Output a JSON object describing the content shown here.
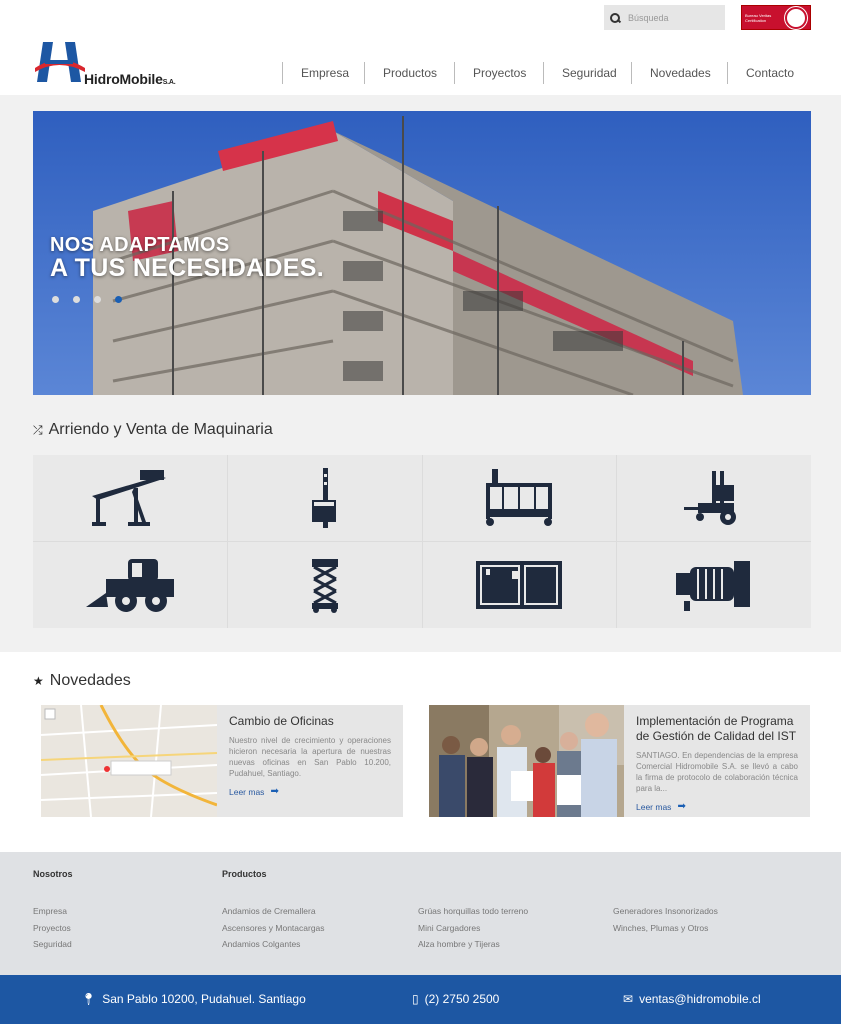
{
  "header": {
    "search_placeholder": "Búsqueda",
    "search_icon": "magnifier-icon",
    "cert_text": "Bureau Veritas Certification",
    "logo_brand": "HidroMobile",
    "logo_suffix": "S.A.",
    "nav": [
      "Empresa",
      "Productos",
      "Proyectos",
      "Seguridad",
      "Novedades",
      "Contacto"
    ]
  },
  "hero": {
    "line1": "NOS ADAPTAMOS",
    "line2": "A TUS NECESIDADES.",
    "slides": 4,
    "active_slide": 4
  },
  "products": {
    "title": "Arriendo y Venta de Maquinaria",
    "icon": "shuffle-icon",
    "items": [
      "gantry-crane-icon",
      "rack-hoist-icon",
      "suspended-platform-icon",
      "truck-mounted-forklift-icon",
      "skid-steer-loader-icon",
      "scissor-lift-icon",
      "generator-icon",
      "winch-icon"
    ]
  },
  "news": {
    "title": "Novedades",
    "icon": "star-icon",
    "cards": [
      {
        "title": "Cambio de Oficinas",
        "text": "Nuestro nivel de crecimiento y operaciones hicieron necesaria la apertura de nuestras nuevas oficinas en San Pablo 10.200, Pudahuel, Santiago.",
        "more": "Leer mas"
      },
      {
        "title": "Implementación de Programa de Gestión de Calidad del IST",
        "text": "SANTIAGO. En dependencias de la empresa Comercial Hidromobile S.A. se llevó a cabo la firma de protocolo de colaboración técnica para la...",
        "more": "Leer mas"
      }
    ]
  },
  "footer": {
    "col1_title": "Nosotros",
    "col1": [
      "Empresa",
      "Proyectos",
      "Seguridad"
    ],
    "col2_title": "Productos",
    "col2": [
      "Andamios de Cremallera",
      "Ascensores y Montacargas",
      "Andamios Colgantes"
    ],
    "col3": [
      "Grúas horquillas todo terreno",
      "Mini Cargadores",
      "Alza hombre y Tijeras"
    ],
    "col4": [
      "Generadores Insonorizados",
      "Winches, Plumas y Otros"
    ]
  },
  "contact": {
    "address": "San Pablo 10200, Pudahuel. Santiago",
    "phone": "(2) 2750 2500",
    "email": "ventas@hidromobile.cl"
  },
  "colors": {
    "brand_blue": "#1d57a3",
    "brand_red": "#d9272e",
    "sky": "#3b6cc7"
  }
}
